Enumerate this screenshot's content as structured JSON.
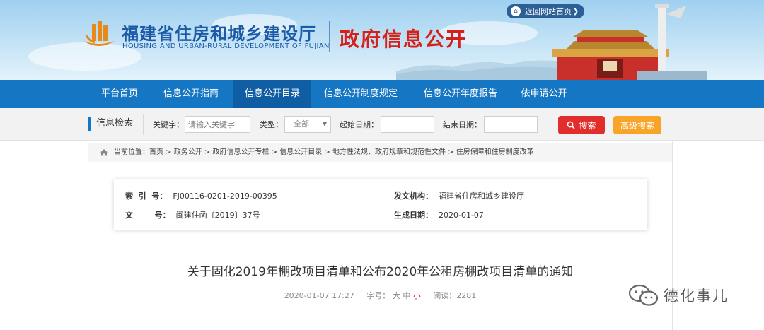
{
  "header": {
    "site_title": "福建省住房和城乡建设厅",
    "site_subtitle": "HOUSING AND URBAN-RURAL DEVELOPMENT OF FUJIAN",
    "section_title": "政府信息公开",
    "home_link": "返回网站首页"
  },
  "nav": {
    "items": [
      {
        "label": "平台首页"
      },
      {
        "label": "信息公开指南"
      },
      {
        "label": "信息公开目录",
        "active": true
      },
      {
        "label": "信息公开制度规定"
      },
      {
        "label": "信息公开年度报告"
      },
      {
        "label": "依申请公开"
      }
    ]
  },
  "search": {
    "label": "信息检索",
    "keyword_label": "关键字：",
    "keyword_placeholder": "请输入关键字",
    "type_label": "类型：",
    "type_value": "全部",
    "start_label": "起始日期：",
    "end_label": "结束日期：",
    "search_button": "搜索",
    "advanced_button": "高级搜索"
  },
  "breadcrumb": "当前位置：首页 > 政务公开 > 政府信息公开专栏 > 信息公开目录 > 地方性法规、政府规章和规范性文件 > 住房保障和住房制度改革",
  "meta": {
    "index_key": "索  引  号：",
    "index_val": "FJ00116-0201-2019-00395",
    "docno_key": "文        号：",
    "docno_val": "闽建住函〔2019〕37号",
    "org_key": "发文机构：",
    "org_val": "福建省住房和城乡建设厅",
    "date_key": "生成日期：",
    "date_val": "2020-01-07"
  },
  "document": {
    "title": "关于固化2019年棚改项目清单和公布2020年公租房棚改项目清单的通知",
    "datetime": "2020-01-07 17:27",
    "font_label": "字号：",
    "font_large": "大",
    "font_medium": "中",
    "font_small": "小",
    "reads_label": "阅读：",
    "reads_value": "2281"
  },
  "watermark": "德化事儿",
  "colors": {
    "nav": "#1576c4",
    "nav_active": "#0f5ea3",
    "title_blue": "#1c5aa8",
    "red": "#d6201a",
    "search_button": "#e12d2b",
    "advanced_button": "#f7a428"
  }
}
